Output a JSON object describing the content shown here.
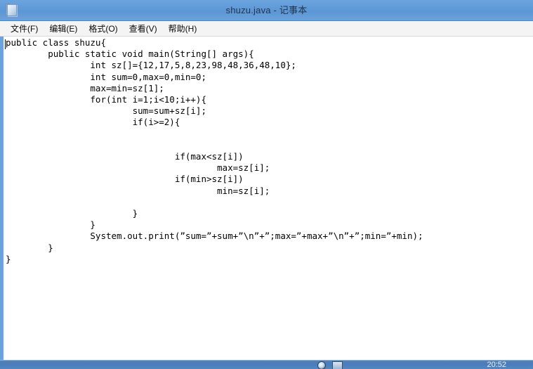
{
  "window": {
    "title": "shuzu.java - 记事本",
    "icon": "notepad-icon"
  },
  "menubar": {
    "items": [
      {
        "label": "文件(F)",
        "name": "menu-file"
      },
      {
        "label": "编辑(E)",
        "name": "menu-edit"
      },
      {
        "label": "格式(O)",
        "name": "menu-format"
      },
      {
        "label": "查看(V)",
        "name": "menu-view"
      },
      {
        "label": "帮助(H)",
        "name": "menu-help"
      }
    ]
  },
  "editor": {
    "content": "public class shuzu{\n        public static void main(String[] args){\n                int sz[]={12,17,5,8,23,98,48,36,48,10};\n                int sum=0,max=0,min=0;\n                max=min=sz[1];\n                for(int i=1;i<10;i++){\n                        sum=sum+sz[i];\n                        if(i>=2){\n\n\n                                if(max<sz[i])\n                                        max=sz[i];\n                                if(min>sz[i])\n                                        min=sz[i];\n\n                        }\n                }\n                System.out.print(”sum=”+sum+”\\n”+”;max=”+max+”\\n”+”;min=”+min);\n        }\n}"
  },
  "taskbar": {
    "clock": "20:52",
    "icons": [
      "browser-icon",
      "folder-icon"
    ]
  },
  "colors": {
    "titlebar": "#5f9ad8",
    "window_frame": "#6aa3de",
    "taskbar": "#4b7cb8",
    "editor_background": "#ffffff",
    "text": "#000000"
  }
}
